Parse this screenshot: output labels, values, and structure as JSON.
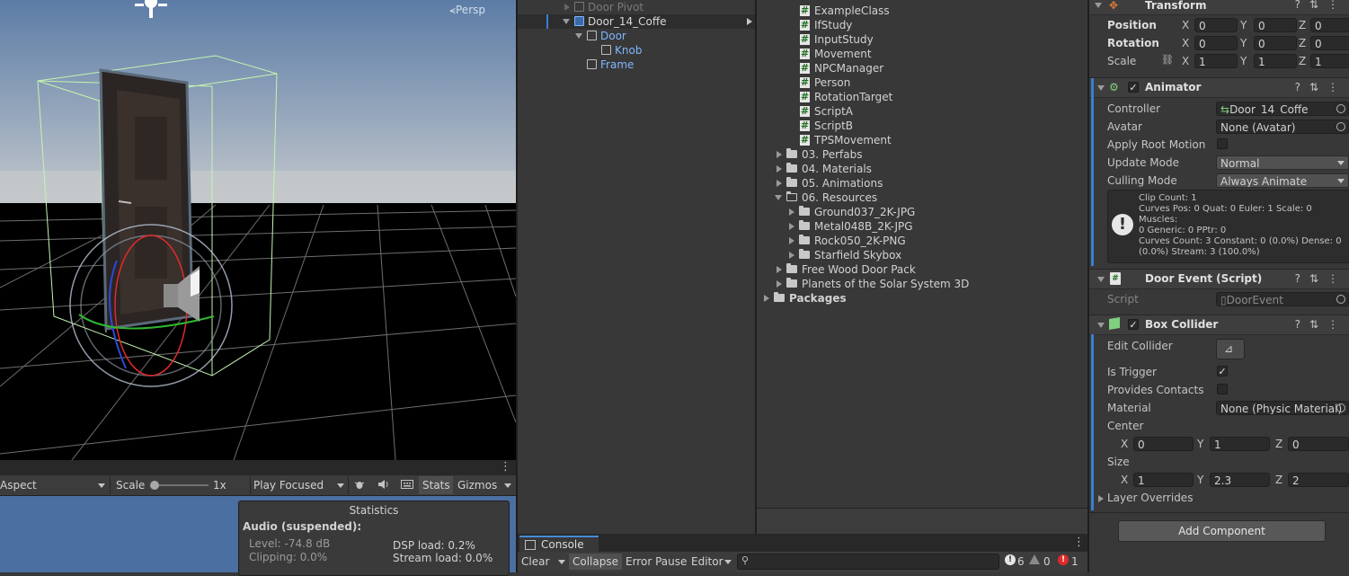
{
  "scene": {
    "projection_label": "Persp",
    "colors": {
      "sky_top": "#5c7ca6",
      "sky_bottom": "#c4c9cd",
      "ground": "#000000",
      "grid": "#7f7f7f",
      "bounds": "#c4f4b0",
      "door": "#2b2523"
    }
  },
  "game": {
    "aspect_label": "Aspect",
    "scale_label": "Scale",
    "scale_value": "1x",
    "play_mode": "Play Focused",
    "stats_label": "Stats",
    "gizmos_label": "Gizmos",
    "statistics": {
      "title": "Statistics",
      "audio_heading": "Audio (suspended):",
      "level": "Level: -74.8 dB",
      "clipping": "Clipping: 0.0%",
      "dsp_load": "DSP load: 0.2%",
      "stream_load": "Stream load: 0.0%"
    }
  },
  "hierarchy": {
    "items": [
      {
        "label": "Door Pivot",
        "style": "dim"
      },
      {
        "label": "Door_14_Coffe",
        "style": "selected"
      },
      {
        "label": "Door",
        "style": "prefab"
      },
      {
        "label": "Knob",
        "style": "prefab"
      },
      {
        "label": "Frame",
        "style": "prefab"
      }
    ]
  },
  "project": {
    "scripts": [
      "ExampleClass",
      "IfStudy",
      "InputStudy",
      "Movement",
      "NPCManager",
      "Person",
      "RotationTarget",
      "ScriptA",
      "ScriptB",
      "TPSMovement"
    ],
    "folders": [
      {
        "label": "03. Perfabs",
        "expanded": false
      },
      {
        "label": "04. Materials",
        "expanded": false
      },
      {
        "label": "05. Animations",
        "expanded": false
      },
      {
        "label": "06. Resources",
        "expanded": true
      }
    ],
    "resource_folders": [
      "Ground037_2K-JPG",
      "Metal048B_2K-JPG",
      "Rock050_2K-PNG",
      "Starfield Skybox"
    ],
    "asset_folders": [
      "Free Wood Door Pack",
      "Planets of the Solar System 3D"
    ],
    "packages_label": "Packages"
  },
  "console": {
    "tab_label": "Console",
    "clear_label": "Clear",
    "collapse_label": "Collapse",
    "error_pause_label": "Error Pause",
    "editor_label": "Editor",
    "info_count": "6",
    "warning_count": "0",
    "error_count": "1"
  },
  "inspector": {
    "transform": {
      "title": "Transform",
      "position_label": "Position",
      "position": {
        "x": "0",
        "y": "0",
        "z": "0"
      },
      "rotation_label": "Rotation",
      "rotation": {
        "x": "0",
        "y": "0",
        "z": "0"
      },
      "scale_label": "Scale",
      "scale": {
        "x": "1",
        "y": "1",
        "z": "1"
      }
    },
    "animator": {
      "title": "Animator",
      "controller_label": "Controller",
      "controller_value": "Door_14_Coffe",
      "avatar_label": "Avatar",
      "avatar_value": "None (Avatar)",
      "apply_root_motion_label": "Apply Root Motion",
      "update_mode_label": "Update Mode",
      "update_mode_value": "Normal",
      "culling_mode_label": "Culling Mode",
      "culling_mode_value": "Always Animate",
      "info_lines": [
        "Clip Count: 1",
        "Curves Pos: 0 Quat: 0 Euler: 1 Scale: 0 Muscles:",
        "0 Generic: 0 PPtr: 0",
        "Curves Count: 3 Constant: 0 (0.0%) Dense: 0",
        "(0.0%) Stream: 3 (100.0%)"
      ]
    },
    "door_event": {
      "title": "Door Event (Script)",
      "script_label": "Script",
      "script_value": "DoorEvent"
    },
    "box_collider": {
      "title": "Box Collider",
      "edit_collider_label": "Edit Collider",
      "is_trigger_label": "Is Trigger",
      "provides_contacts_label": "Provides Contacts",
      "material_label": "Material",
      "material_value": "None (Physic Material)",
      "center_label": "Center",
      "center": {
        "x": "0",
        "y": "1",
        "z": "0"
      },
      "size_label": "Size",
      "size": {
        "x": "1",
        "y": "2.3",
        "z": "2"
      },
      "layer_overrides_label": "Layer Overrides"
    },
    "add_component_label": "Add Component",
    "axis_labels": {
      "x": "X",
      "y": "Y",
      "z": "Z"
    }
  }
}
